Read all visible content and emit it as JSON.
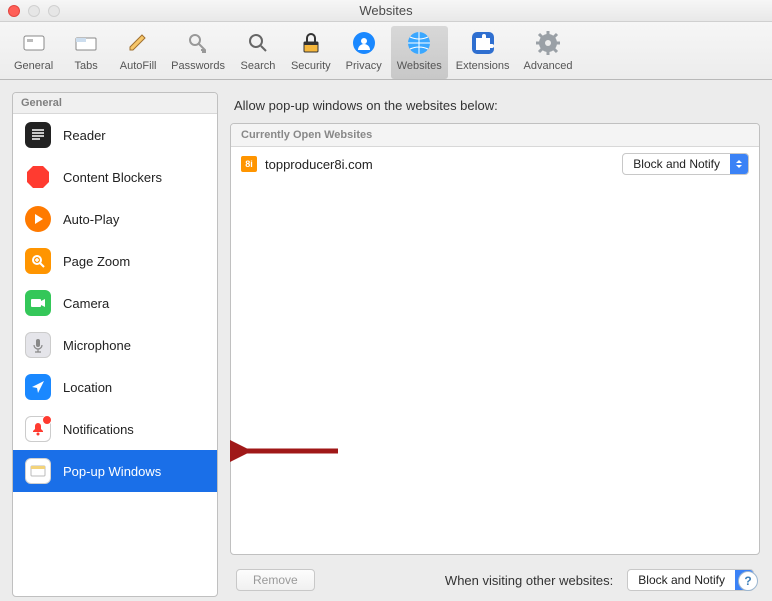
{
  "window": {
    "title": "Websites"
  },
  "toolbar": {
    "items": [
      {
        "label": "General"
      },
      {
        "label": "Tabs"
      },
      {
        "label": "AutoFill"
      },
      {
        "label": "Passwords"
      },
      {
        "label": "Search"
      },
      {
        "label": "Security"
      },
      {
        "label": "Privacy"
      },
      {
        "label": "Websites"
      },
      {
        "label": "Extensions"
      },
      {
        "label": "Advanced"
      }
    ]
  },
  "sidebar": {
    "header": "General",
    "items": [
      {
        "label": "Reader"
      },
      {
        "label": "Content Blockers"
      },
      {
        "label": "Auto-Play"
      },
      {
        "label": "Page Zoom"
      },
      {
        "label": "Camera"
      },
      {
        "label": "Microphone"
      },
      {
        "label": "Location"
      },
      {
        "label": "Notifications"
      },
      {
        "label": "Pop-up Windows"
      }
    ]
  },
  "main": {
    "caption": "Allow pop-up windows on the websites below:",
    "table_header": "Currently Open Websites",
    "rows": [
      {
        "favicon_text": "8i",
        "site": "topproducer8i.com",
        "action": "Block and Notify"
      }
    ],
    "remove_label": "Remove",
    "default_label": "When visiting other websites:",
    "default_value": "Block and Notify"
  },
  "help": {
    "glyph": "?"
  }
}
